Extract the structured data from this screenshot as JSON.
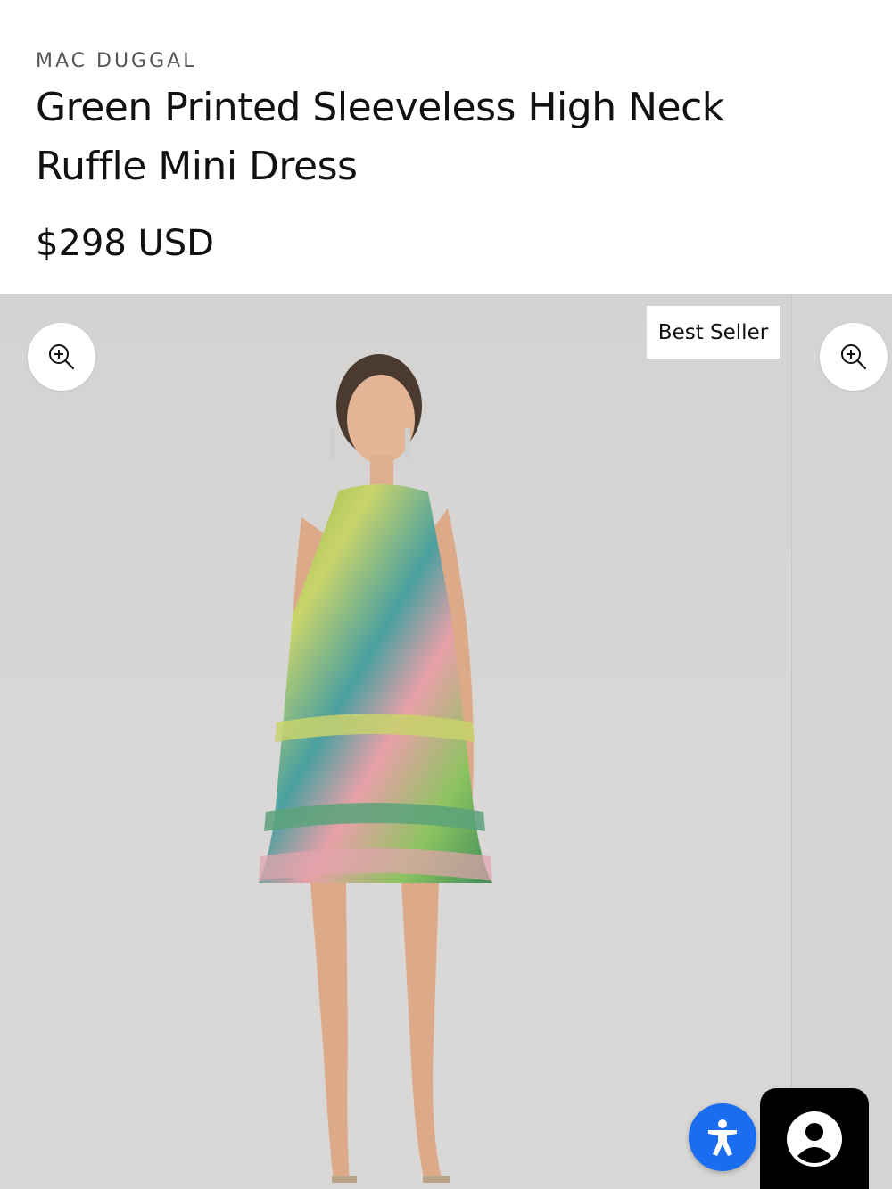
{
  "product": {
    "brand": "MAC DUGGAL",
    "title": "Green Printed Sleeveless High Neck Ruffle Mini Dress",
    "price": "$298 USD"
  },
  "gallery": {
    "badge": "Best Seller",
    "icons": [
      "zoom-in-icon",
      "accessibility-icon",
      "account-icon"
    ]
  },
  "colors": {
    "accessibility_button": "#1a6cf0",
    "account_button": "#000000",
    "photo_background": "#d8d6d4"
  }
}
